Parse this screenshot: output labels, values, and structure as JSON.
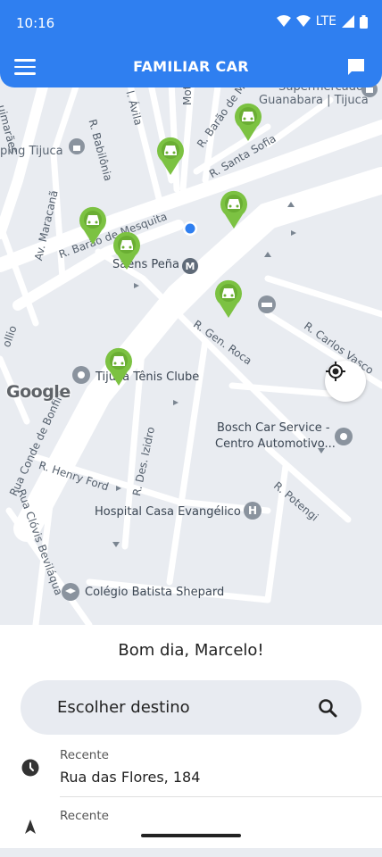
{
  "status_bar": {
    "time": "10:16",
    "network": "LTE"
  },
  "app_bar": {
    "title": "FAMILIAR CAR",
    "menu_icon": "menu-icon",
    "chat_icon": "chat-icon"
  },
  "map": {
    "labels": {
      "ping_tijuca": "ping Tijuca",
      "supermercados": "Supermercados",
      "guanabara_tijuca": "Guanabara | Tijuca",
      "r_babilonia": "R. Babilônia",
      "r_avila": "l. Ávila",
      "r_mota": "Mota",
      "r_barao_mesquita_top": "R. Barão de Mes",
      "r_santa_sofia": "R. Santa Sofia",
      "av_maracana": "Av. Maracanã",
      "r_barao_mesquita": "R. Barão de Mesquita",
      "saens_pena": "Saens Peña",
      "tijuca_tenis": "Tijuca Tênis Clube",
      "r_gen_roca": "R. Gen. Roca",
      "r_carlos_vasconcelos": "R. Carlos Vasco",
      "bosch_1": "Bosch Car Service -",
      "bosch_2": "Centro Automotivo...",
      "rua_conde_bonfim": "Rua Conde de Bonfim",
      "r_henry_ford": "R. Henry Ford",
      "r_des_izidro": "R. Des. Izidro",
      "r_potengi": "R. Potengi",
      "hospital": "Hospital Casa Evangélico",
      "rua_clovis": "Rua Clóvis Beviláqua",
      "colegio": "Colégio Batista Shepard",
      "guimaraes": "uimarães",
      "ollio": "ollio"
    },
    "google_logo": "Google",
    "car_pin_color": "#7cc242",
    "metro_icon": "metro-icon",
    "my_location_icon": "my-location-icon"
  },
  "sheet": {
    "greeting": "Bom dia, Marcelo!",
    "search": {
      "label": "Escolher destino",
      "icon": "search-icon"
    },
    "recents": [
      {
        "label": "Recente",
        "address": "Rua das Flores, 184",
        "icon": "clock-icon"
      },
      {
        "label": "Recente",
        "address": "",
        "icon": "navigation-icon"
      }
    ]
  },
  "colors": {
    "primary": "#2f7ff0",
    "map_bg": "#e9ecf1",
    "road": "#ffffff"
  }
}
